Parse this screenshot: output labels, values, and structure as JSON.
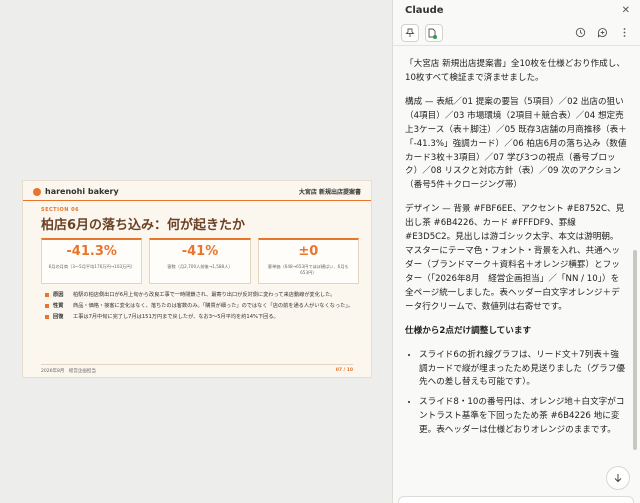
{
  "slide": {
    "brand": "harenohi bakery",
    "doc_title": "大宮店 新規出店提案書",
    "section_label": "SECTION 06",
    "heading": "柏店6月の落ち込み：何が起きたか",
    "cards": [
      {
        "value": "-41.3%",
        "note": "6月の月商（3〜5月平均176万円→103万円）"
      },
      {
        "value": "-41%",
        "note": "客数（月2,700人前後→1,588人）"
      },
      {
        "value": "±0",
        "note": "客単価（648→653円でほぼ横ばい、6月も653円）"
      }
    ],
    "points": [
      {
        "label": "原因",
        "text": "柏駅の柏店側出口が6月上旬から改良工事で一時閉鎖され、最寄り出口が反対側に変わって来店動線が変化した。"
      },
      {
        "label": "性質",
        "text": "商品・価格・接客に変化はなく、落ちたのは客数のみ。「購買が細った」のではなく「店の前を通る人がいなくなった」。"
      },
      {
        "label": "回復",
        "text": "工事は7月中旬に完了し7月は151万円まで戻したが、なお3〜5月平均を約14%下回る。"
      }
    ],
    "footer_left": "2026年8月　経営企画担当",
    "footer_right": "07 / 10"
  },
  "panel": {
    "title": "Claude",
    "close_label": "✕",
    "paragraphs": [
      "「大宮店 新規出店提案書」全10枚を仕様どおり作成し、10枚すべて検証まで済ませました。",
      "構成 — 表紙／01 提案の要旨（5項目）／02 出店の狙い（4項目）／03 市場環境（2項目＋競合表）／04 想定売上3ケース（表＋脚注）／05 既存3店舗の月商推移（表＋「-41.3%」強調カード）／06 柏店6月の落ち込み（数値カード3枚＋3項目）／07 学び3つの視点（番号ブロック）／08 リスクと対応方針（表）／09 次のアクション（番号5件＋クロージング帯）",
      "デザイン — 背景 #FBF6EE、アクセント #E8752C、見出し茶 #6B4226、カード #FFFDF9、罫線 #E3D5C2。見出しは游ゴシック太字、本文は游明朝。マスターにテーマ色・フォント・背景を入れ、共通ヘッダー（ブランドマーク＋資料名＋オレンジ横罫）とフッター（「2026年8月　経営企画担当」／「NN / 10」）を全ページ統一しました。表ヘッダー白文字オレンジ＋データ行クリームで、数値列は右寄せです。",
      "仕様から2点だけ調整しています"
    ],
    "bullets": [
      "スライド6の折れ線グラフは、リード文＋7列表＋強調カードで縦が埋まったため見送りました（グラフ優先への差し替えも可能です）。",
      "スライド8・10の番号円は、オレンジ地＋白文字がコントラスト基準を下回ったため茶 #6B4226 地に変更。表ヘッダーは仕様どおりオレンジのままです。"
    ]
  },
  "colors": {
    "accent": "#E8752C",
    "brown": "#6B4226",
    "background": "#FBF6EE",
    "card": "#FFFDF9",
    "rule": "#E3D5C2"
  }
}
